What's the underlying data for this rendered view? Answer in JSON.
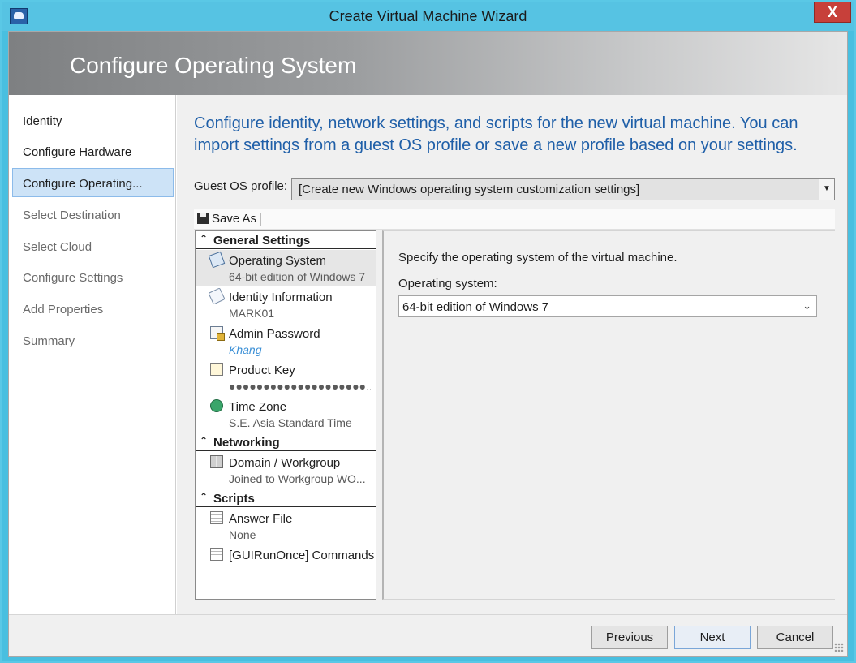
{
  "window": {
    "title": "Create Virtual Machine Wizard",
    "close_label": "X"
  },
  "banner": {
    "title": "Configure Operating System"
  },
  "nav": {
    "items": [
      {
        "label": "Identity",
        "state": "enabled"
      },
      {
        "label": "Configure Hardware",
        "state": "enabled"
      },
      {
        "label": "Configure Operating...",
        "state": "selected"
      },
      {
        "label": "Select Destination",
        "state": "disabled"
      },
      {
        "label": "Select Cloud",
        "state": "disabled"
      },
      {
        "label": "Configure Settings",
        "state": "disabled"
      },
      {
        "label": "Add Properties",
        "state": "disabled"
      },
      {
        "label": "Summary",
        "state": "disabled"
      }
    ]
  },
  "main": {
    "intro": "Configure identity, network settings, and scripts for the new virtual machine. You can import settings from a guest OS profile or save a new profile based on your settings.",
    "profile_label": "Guest OS profile:",
    "profile_value": "[Create new Windows operating system customization settings]",
    "toolbar": {
      "save_as": "Save As"
    }
  },
  "settings": {
    "groups": [
      {
        "label": "General Settings",
        "items": [
          {
            "title": "Operating System",
            "value": "64-bit edition of Windows 7",
            "icon": "os-icon"
          },
          {
            "title": "Identity Information",
            "value": "MARK01",
            "icon": "identity-icon"
          },
          {
            "title": "Admin Password",
            "value": "Khang",
            "icon": "password-icon"
          },
          {
            "title": "Product Key",
            "value": "●●●●●●●●●●●●●●●●●●●●...",
            "icon": "key-icon"
          },
          {
            "title": "Time Zone",
            "value": "S.E. Asia Standard Time",
            "icon": "clock-icon"
          }
        ]
      },
      {
        "label": "Networking",
        "items": [
          {
            "title": "Domain / Workgroup",
            "value": "Joined to Workgroup WO...",
            "icon": "network-icon"
          }
        ]
      },
      {
        "label": "Scripts",
        "items": [
          {
            "title": "Answer File",
            "value": "None",
            "icon": "file-icon"
          },
          {
            "title": "[GUIRunOnce] Commands",
            "value": "",
            "icon": "file-icon"
          }
        ]
      }
    ]
  },
  "detail": {
    "description": "Specify the operating system of the virtual machine.",
    "os_label": "Operating system:",
    "os_value": "64-bit edition of Windows 7"
  },
  "footer": {
    "previous": "Previous",
    "next": "Next",
    "cancel": "Cancel"
  },
  "colors": {
    "title_bar": "#56c3e3",
    "intro_text": "#1f5fa8",
    "close_button": "#c7403a",
    "nav_selected": "#cde3f7"
  }
}
